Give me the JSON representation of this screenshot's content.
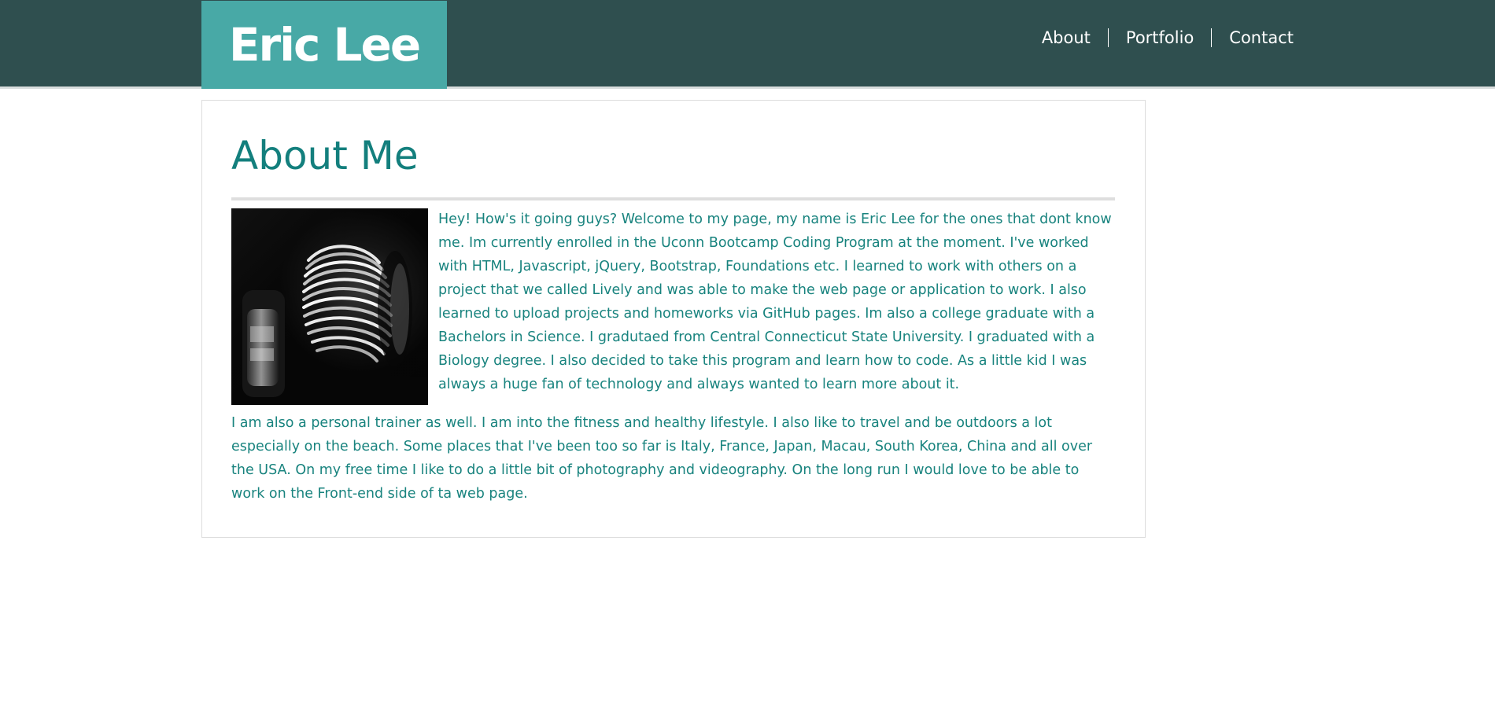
{
  "header": {
    "brand": "Eric Lee",
    "nav": [
      {
        "label": "About"
      },
      {
        "label": "Portfolio"
      },
      {
        "label": "Contact"
      }
    ]
  },
  "colors": {
    "header_bg": "#2f4f4f",
    "brand_bg": "#48a9a6",
    "text_accent": "#137f7d"
  },
  "about": {
    "title": "About Me",
    "paragraphs": [
      "Hey! How's it going guys? Welcome to my page, my name is Eric Lee for the ones that dont know me. Im currently enrolled in the Uconn Bootcamp Coding Program at the moment. I've worked with HTML, Javascript, jQuery, Bootstrap, Foundations etc. I learned to work with others on a project that we called Lively and was able to make the web page or application to work. I also learned to upload projects and homeworks via GitHub pages. Im also a college graduate with a Bachelors in Science. I gradutaed from Central Connecticut State University. I graduated with a Biology degree. I also decided to take this program and learn how to code. As a little kid I was always a huge fan of technology and always wanted to learn more about it.",
      "I am also a personal trainer as well. I am into the fitness and healthy lifestyle. I also like to travel and be outdoors a lot especially on the beach. Some places that I've been too so far is Italy, France, Japan, Macau, South Korea, China and all over the USA. On my free time I like to do a little bit of photography and videography. On the long run I would love to be able to work on the Front-end side of ta web page."
    ]
  }
}
